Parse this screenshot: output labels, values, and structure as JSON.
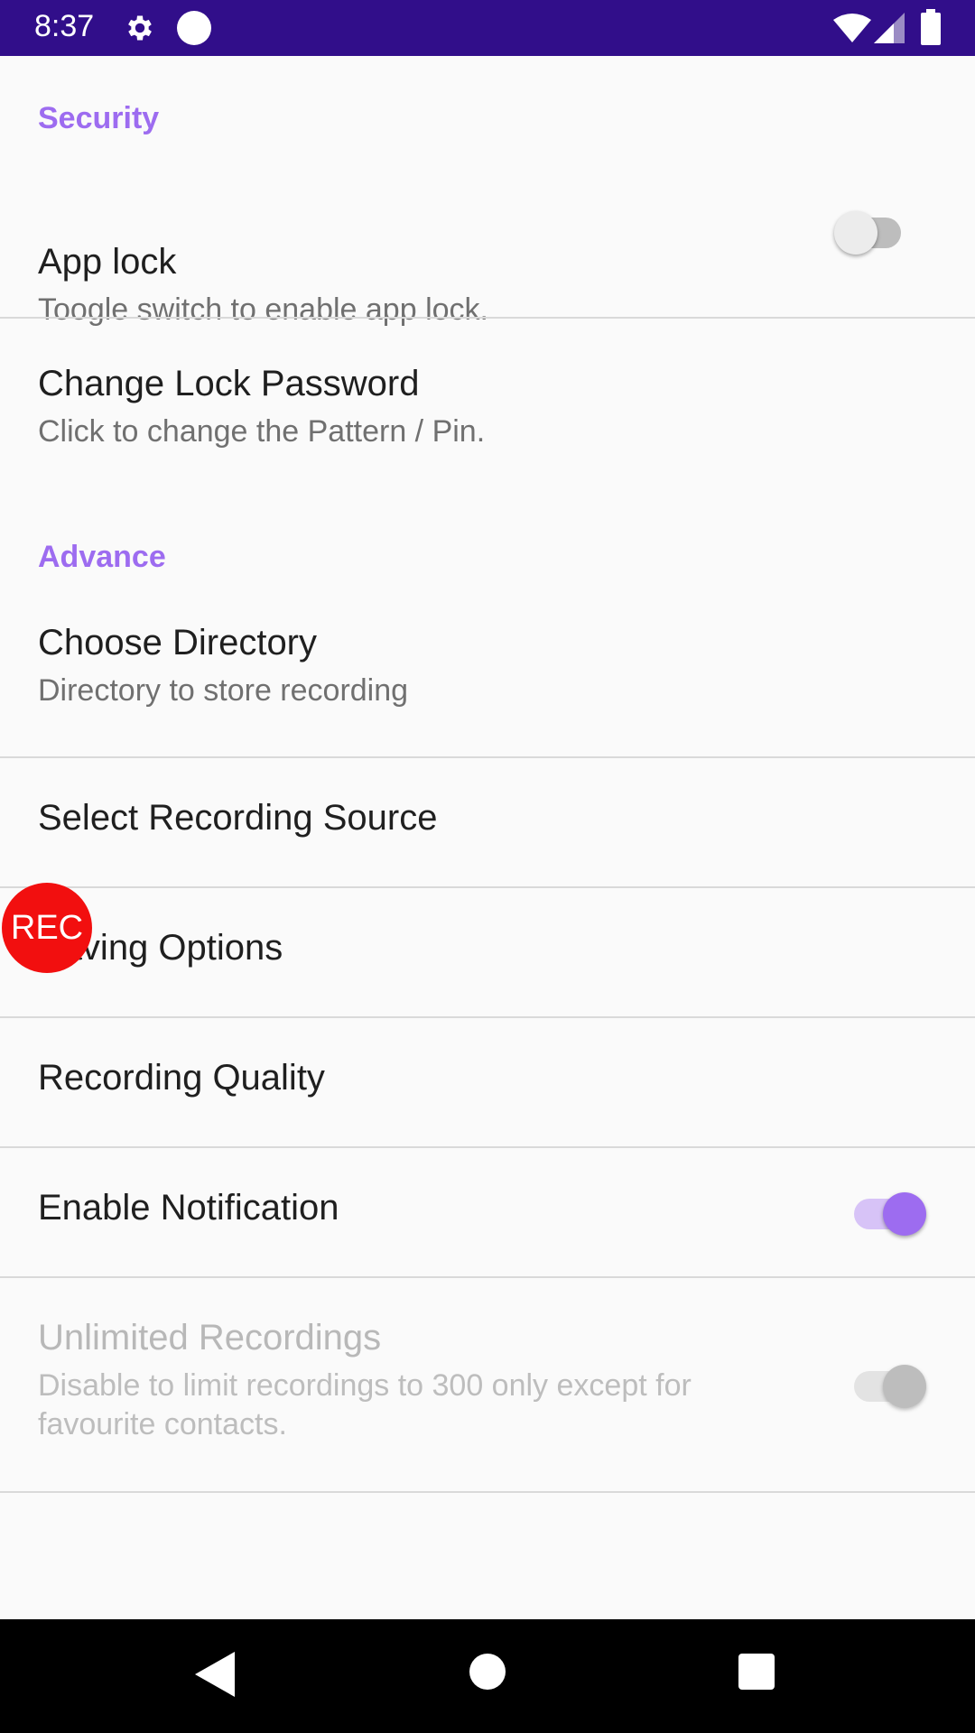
{
  "status_bar": {
    "time": "8:37",
    "icons": [
      "gear-icon",
      "circle-icon",
      "wifi-icon",
      "signal-icon",
      "battery-icon"
    ],
    "background": "#310E8A"
  },
  "sections": {
    "security": {
      "label": "Security"
    },
    "advance": {
      "label": "Advance"
    }
  },
  "prefs": {
    "app_lock": {
      "title": "App lock",
      "summary": "Toogle switch to enable app lock.",
      "switch_on": false
    },
    "change_password": {
      "title": "Change Lock Password",
      "summary": "Click to change the Pattern / Pin."
    },
    "choose_directory": {
      "title": "Choose Directory",
      "summary": "Directory to store recording"
    },
    "recording_source": {
      "title": "Select Recording Source"
    },
    "saving_options": {
      "title": "Saving Options"
    },
    "recording_quality": {
      "title": "Recording Quality"
    },
    "enable_notification": {
      "title": "Enable Notification",
      "switch_on": true
    },
    "unlimited_recordings": {
      "title": "Unlimited Recordings",
      "summary": "Disable to limit recordings to 300 only except for favourite contacts.",
      "switch_on": true,
      "enabled": false
    }
  },
  "rec_bubble": {
    "label": "REC",
    "color": "#F20F0F"
  },
  "accent_color": "#9D6CF0",
  "nav_bar": {
    "icons": [
      "back-icon",
      "home-icon",
      "recents-icon"
    ]
  }
}
